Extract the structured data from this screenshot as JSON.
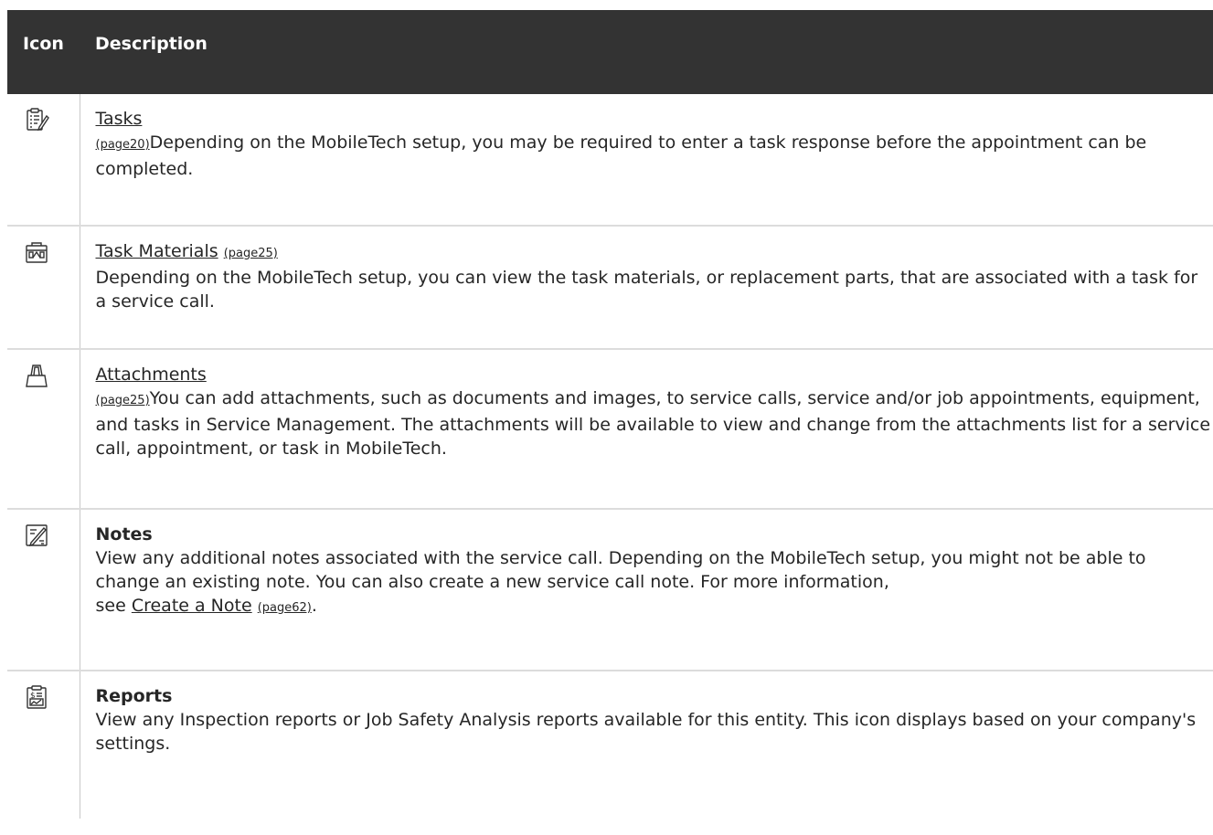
{
  "table": {
    "header": {
      "icon_col": "Icon",
      "desc_col": "Description"
    },
    "rows": [
      {
        "icon": "tasks-clipboard-icon",
        "title": "Tasks",
        "page_ref": "(page20)",
        "text": "Depending on the MobileTech setup, you may be required to enter a task response before the appointment can be completed."
      },
      {
        "icon": "toolbox-icon",
        "title": "Task Materials",
        "page_ref": "(page25)",
        "text": "Depending on the MobileTech setup, you can view the task materials, or replacement parts, that are associated with a task for a service call."
      },
      {
        "icon": "binder-clip-icon",
        "title": "Attachments",
        "page_ref": "(page25)",
        "text": "You can add attachments, such as documents and images, to service calls, service and/or job appointments, equipment, and tasks in Service Management. The attachments will be available to view and change from the attachments list for a service call, appointment, or task in MobileTech."
      },
      {
        "icon": "notes-pencil-icon",
        "title": "Notes",
        "text": "View any additional notes associated with the service call. Depending on the MobileTech setup, you might not be able to change an existing note. You can also create a new service call note. For more information,",
        "see_prefix": "see",
        "link_text": "Create a Note",
        "link_page_ref": "(page62)",
        "suffix": "."
      },
      {
        "icon": "reports-clipboard-icon",
        "title": "Reports",
        "text": "View any Inspection reports or Job Safety Analysis reports available for this entity. This icon displays based on your company's settings."
      }
    ]
  }
}
